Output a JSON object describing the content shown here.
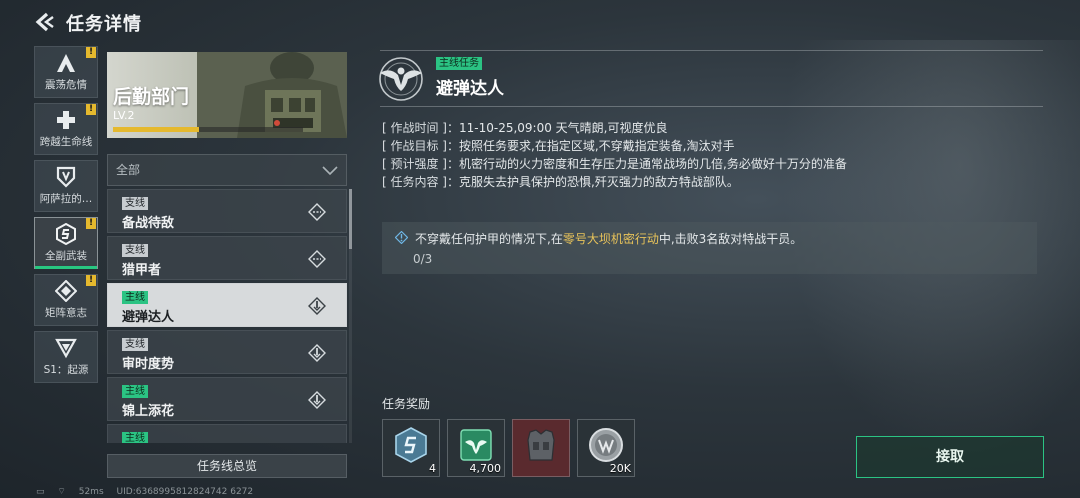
{
  "header": {
    "title": "任务详情"
  },
  "side_tabs": [
    {
      "label": "震荡危情",
      "icon": "triangle-a-icon",
      "alert": true
    },
    {
      "label": "跨越生命线",
      "icon": "plus-cross-icon",
      "alert": true
    },
    {
      "label": "阿萨拉的…",
      "icon": "shield-v-icon",
      "alert": false
    },
    {
      "label": "全副武装",
      "icon": "armor-s-icon",
      "alert": true,
      "active": true
    },
    {
      "label": "矩阵意志",
      "icon": "diamond-matrix-icon",
      "alert": true
    },
    {
      "label": "S1：起源",
      "icon": "chevron-v-icon",
      "alert": false
    }
  ],
  "department": {
    "name": "后勤部门",
    "level": "LV.2",
    "progress": 0.45
  },
  "filter": {
    "selected": "全部"
  },
  "tasks": [
    {
      "tag": "支线",
      "type": "side",
      "name": "备战待敌"
    },
    {
      "tag": "支线",
      "type": "side",
      "name": "猎甲者"
    },
    {
      "tag": "主线",
      "type": "main",
      "name": "避弹达人",
      "selected": true
    },
    {
      "tag": "支线",
      "type": "side",
      "name": "审时度势"
    },
    {
      "tag": "主线",
      "type": "main",
      "name": "锦上添花"
    },
    {
      "tag": "主线",
      "type": "main",
      "name": ""
    }
  ],
  "overview_button": "任务线总览",
  "status_bar": {
    "ping": "52ms",
    "uid": "UID:6368995812824742 6272"
  },
  "detail": {
    "type_tag": "主线任务",
    "title": "避弹达人",
    "info": [
      {
        "key": "[ 作战时间 ]：",
        "value": "11-10-25,09:00 天气晴朗,可视度优良"
      },
      {
        "key": "[ 作战目标 ]：",
        "value": "按照任务要求,在指定区域,不穿戴指定装备,淘汰对手"
      },
      {
        "key": "[ 预计强度 ]：",
        "value": "机密行动的火力密度和生存压力是通常战场的几倍,务必做好十万分的准备"
      },
      {
        "key": "[ 任务内容 ]：",
        "value": "克服失去护具保护的恐惧,歼灭强力的敌方特战部队。"
      }
    ],
    "objective": {
      "before": "不穿戴任何护甲的情况下,在",
      "highlight": "零号大坝机密行动",
      "after": "中,击败3名敌对特战干员。",
      "progress": "0/3"
    },
    "rewards_label": "任务奖励",
    "rewards": [
      {
        "icon": "hex-badge-icon",
        "qty": "4"
      },
      {
        "icon": "green-emblem-icon",
        "qty": "4,700"
      },
      {
        "icon": "vest-icon",
        "qty": ""
      },
      {
        "icon": "silver-coin-icon",
        "qty": "20K"
      }
    ],
    "accept_label": "接取"
  },
  "colors": {
    "accent": "#2bc383",
    "alert": "#e5b92e",
    "highlight": "#e8c35a"
  }
}
